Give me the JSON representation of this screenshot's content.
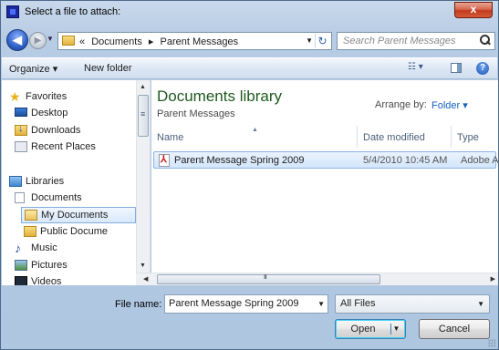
{
  "window": {
    "title": "Select a file to attach:",
    "close_label": "x"
  },
  "address": {
    "crumbs": [
      "«",
      "Documents",
      "▸",
      "Parent Messages"
    ],
    "search_placeholder": "Search Parent Messages"
  },
  "toolbar": {
    "organize_label": "Organize ▾",
    "new_folder_label": "New folder",
    "views_label": "☷ ▾",
    "help_label": "?"
  },
  "nav": {
    "items": [
      {
        "label": "Favorites",
        "icon": "star-icon"
      },
      {
        "label": "Desktop",
        "icon": "desktop-icon"
      },
      {
        "label": "Downloads",
        "icon": "downloads-icon"
      },
      {
        "label": "Recent Places",
        "icon": "recent-places-icon"
      },
      {
        "label": "Libraries",
        "icon": "libraries-icon"
      },
      {
        "label": "Documents",
        "icon": "documents-icon"
      },
      {
        "label": "My Documents",
        "icon": "folder-open-icon"
      },
      {
        "label": "Public Docume",
        "icon": "folder-icon"
      },
      {
        "label": "Music",
        "icon": "music-icon"
      },
      {
        "label": "Pictures",
        "icon": "pictures-icon"
      },
      {
        "label": "Videos",
        "icon": "videos-icon"
      }
    ]
  },
  "content": {
    "library_title": "Documents library",
    "library_subtitle": "Parent Messages",
    "arrange_label": "Arrange by:",
    "arrange_value": "Folder ▾",
    "columns": [
      "Name",
      "Date modified",
      "Type"
    ],
    "files": [
      {
        "name": "Parent Message Spring 2009",
        "date": "5/4/2010 10:45 AM",
        "type": "Adobe Ac"
      }
    ]
  },
  "footer": {
    "filename_label": "File name:",
    "filename_value": "Parent Message Spring 2009",
    "filter_value": "All Files",
    "open_label": "Open",
    "cancel_label": "Cancel"
  }
}
